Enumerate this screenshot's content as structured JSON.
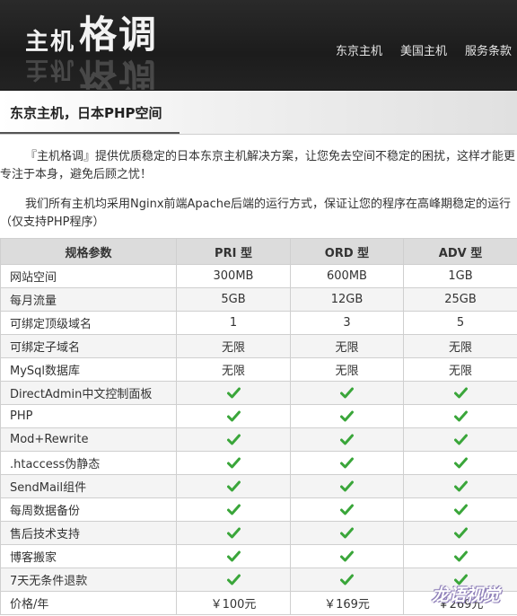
{
  "header": {
    "logo_small": "主机",
    "logo_big": "格调",
    "nav": [
      "东京主机",
      "美国主机",
      "服务条款"
    ]
  },
  "title": "东京主机，日本PHP空间",
  "intro": [
    "『主机格调』提供优质稳定的日本东京主机解决方案，让您免去空间不稳定的困扰，这样才能更专注于本身，避免后顾之忧！",
    "我们所有主机均采用Nginx前端Apache后端的运行方式，保证让您的程序在高峰期稳定的运行（仅支持PHP程序）"
  ],
  "table": {
    "headers": [
      "规格参数",
      "PRI 型",
      "ORD 型",
      "ADV 型"
    ],
    "rows": [
      {
        "label": "网站空间",
        "values": [
          "300MB",
          "600MB",
          "1GB"
        ]
      },
      {
        "label": "每月流量",
        "values": [
          "5GB",
          "12GB",
          "25GB"
        ]
      },
      {
        "label": "可绑定顶级域名",
        "values": [
          "1",
          "3",
          "5"
        ]
      },
      {
        "label": "可绑定子域名",
        "values": [
          "无限",
          "无限",
          "无限"
        ]
      },
      {
        "label": "MySql数据库",
        "values": [
          "无限",
          "无限",
          "无限"
        ]
      },
      {
        "label": "DirectAdmin中文控制面板",
        "check": true
      },
      {
        "label": "PHP",
        "check": true
      },
      {
        "label": "Mod+Rewrite",
        "check": true
      },
      {
        "label": ".htaccess伪静态",
        "check": true
      },
      {
        "label": "SendMail组件",
        "check": true
      },
      {
        "label": "每周数据备份",
        "check": true
      },
      {
        "label": "售后技术支持",
        "check": true
      },
      {
        "label": "博客搬家",
        "check": true
      },
      {
        "label": "7天无条件退款",
        "check": true
      },
      {
        "label": "价格/年",
        "values": [
          "￥100元",
          "￥169元",
          "￥269元"
        ]
      }
    ]
  },
  "check_icon": "check-icon",
  "check_color": "#3aa63a",
  "watermark": "龙语视觉"
}
